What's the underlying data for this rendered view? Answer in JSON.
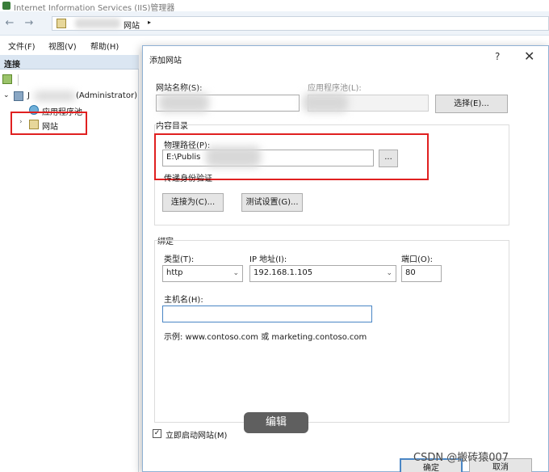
{
  "window": {
    "title": "Internet Information Services (IIS)管理器"
  },
  "address": {
    "path_item": "网站",
    "separator": "▸"
  },
  "menu": {
    "file": "文件(F)",
    "view": "视图(V)",
    "help": "帮助(H)"
  },
  "connections": {
    "header": "连接",
    "server_label": "(Administrator)",
    "server_prefix": "J",
    "app_pools": "应用程序池",
    "sites": "网站"
  },
  "dialog": {
    "title": "添加网站",
    "help": "?",
    "close": "✕",
    "site_name_label": "网站名称(S):",
    "app_pool_label": "应用程序池(L):",
    "select_button": "选择(E)...",
    "content_dir_label": "内容目录",
    "physical_path_label": "物理路径(P):",
    "physical_path_value": "E:\\Publis",
    "browse_button": "...",
    "passthrough_label": "传递身份验证",
    "connect_as_button": "连接为(C)...",
    "test_settings_button": "测试设置(G)...",
    "binding_label": "绑定",
    "type_label": "类型(T):",
    "type_value": "http",
    "ip_label": "IP 地址(I):",
    "ip_value": "192.168.1.105",
    "port_label": "端口(O):",
    "port_value": "80",
    "hostname_label": "主机名(H):",
    "hostname_value": "",
    "example_text": "示例: www.contoso.com 或 marketing.contoso.com",
    "start_now_label": "立即启动网站(M)",
    "start_now_checked": true,
    "ok_button": "确定",
    "cancel_button": "取消"
  },
  "overlay": {
    "edit_badge": "编辑",
    "watermark": "CSDN @搬砖猿007"
  },
  "colors": {
    "highlight_red": "#e02020",
    "accent_blue": "#4a86c5"
  }
}
